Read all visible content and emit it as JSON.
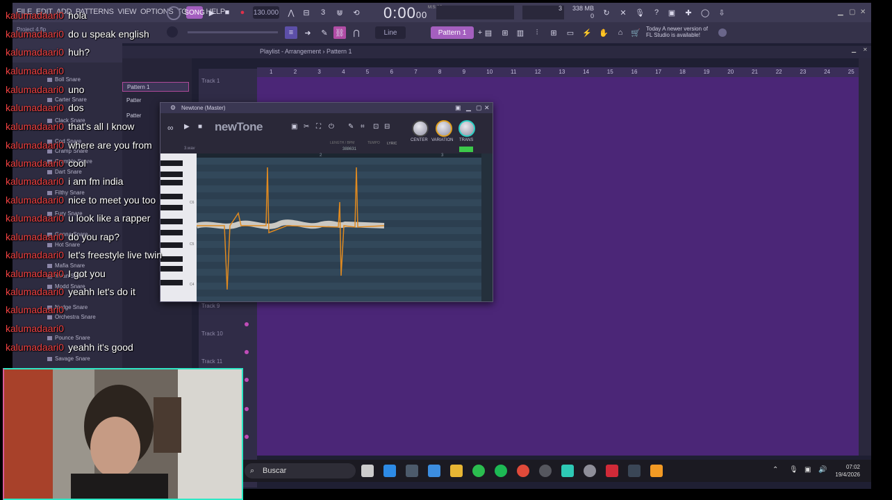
{
  "menu": [
    "FILE",
    "EDIT",
    "ADD",
    "PATTERNS",
    "VIEW",
    "OPTIONS",
    "TOOLS",
    "HELP"
  ],
  "transport": {
    "tempo": "130.000",
    "time_main": "0:00",
    "time_sub": "00",
    "time_unit": "M:S:CS"
  },
  "cpu": {
    "mem": "338 MB",
    "val1": "3",
    "val2": "0"
  },
  "project": {
    "name": "Project 4.flp"
  },
  "newer_version": {
    "line1": "Today  A newer version of",
    "line2": "FL Studio is available!"
  },
  "toolbar": {
    "snap": "Line",
    "pattern": "Pattern 1"
  },
  "playlist": {
    "title": "Playlist - Arrangement › Pattern 1",
    "pattern_item": "Pattern 1",
    "pattern_item_2": "Patter",
    "pattern_item_3": "Patter",
    "ruler": [
      "1",
      "2",
      "3",
      "4",
      "5",
      "6",
      "7",
      "8",
      "9",
      "10",
      "11",
      "12",
      "13",
      "14",
      "15",
      "16",
      "17",
      "18",
      "19",
      "20",
      "21",
      "22",
      "23",
      "24",
      "25"
    ],
    "tracks": [
      "Track 1",
      "Track 9",
      "Track 10",
      "Track 11"
    ]
  },
  "browser": {
    "items": [
      "Boll Snare",
      "Carter Snare",
      "Clack Snare",
      "Cod Snare",
      "Cramp Snare",
      "Crumble Snare",
      "Dart Snare",
      "Filthy Snare",
      "Fury Snare",
      "Gonna Snare",
      "Hot Snare",
      "Mafia Snare",
      "Mean Snare",
      "Modd Snare",
      "Nudge Snare",
      "Orchestra Snare",
      "Pounce Snare",
      "Savage Snare"
    ]
  },
  "newtone": {
    "title": "Newtone (Master)",
    "logo": "newTone",
    "knobs": [
      "CENTER",
      "VARIATION",
      "TRANS"
    ],
    "info_label": "LENGTH / BPM",
    "info_value": "388631",
    "tempo_label": "TEMPO",
    "lyric": "LYRIC",
    "file": "3.wav",
    "ruler": [
      "2",
      "3"
    ],
    "keys": [
      "C6",
      "C5",
      "C4"
    ]
  },
  "chat": [
    {
      "user": "kalumadaari0",
      "text": "hola"
    },
    {
      "user": "kalumadaari0",
      "text": "do u speak english"
    },
    {
      "user": "kalumadaari0",
      "text": "huh?"
    },
    {
      "user": "kalumadaari0",
      "text": ""
    },
    {
      "user": "kalumadaari0",
      "text": "uno"
    },
    {
      "user": "kalumadaari0",
      "text": "dos"
    },
    {
      "user": "kalumadaari0",
      "text": "that's all I know"
    },
    {
      "user": "kalumadaari0",
      "text": "where are you from"
    },
    {
      "user": "kalumadaari0",
      "text": "cool"
    },
    {
      "user": "kalumadaari0",
      "text": "i am fm india"
    },
    {
      "user": "kalumadaari0",
      "text": "nice to meet you too"
    },
    {
      "user": "kalumadaari0",
      "text": "u look like a rapper"
    },
    {
      "user": "kalumadaari0",
      "text": "do you rap?"
    },
    {
      "user": "kalumadaari0",
      "text": "let's freestyle live twin"
    },
    {
      "user": "kalumadaari0",
      "text": "I got you"
    },
    {
      "user": "kalumadaari0",
      "text": "yeahh let's do it"
    },
    {
      "user": "kalumadaari0",
      "text": ""
    },
    {
      "user": "kalumadaari0",
      "text": ""
    },
    {
      "user": "kalumadaari0",
      "text": "yeahh it's good"
    }
  ],
  "taskbar": {
    "search_placeholder": "Buscar",
    "time": "07:02",
    "date": "19/4/2026"
  },
  "colors": {
    "arrangement_bg": "#4b2677",
    "chat_user": "#f04040",
    "accent": "#a45fbf",
    "pitch_line": "#e08a20"
  }
}
